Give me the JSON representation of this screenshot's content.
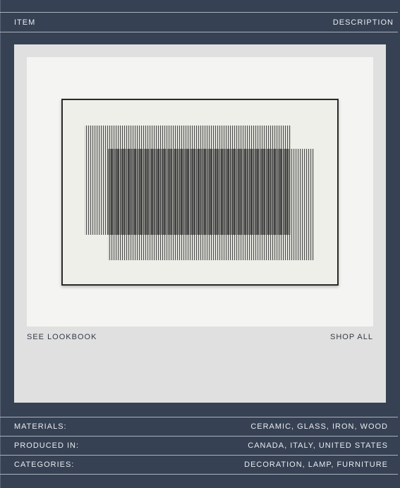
{
  "header": {
    "item_label": "ITEM",
    "description_label": "DESCRIPTION"
  },
  "product_card": {
    "image_alt": "rug",
    "see_lookbook": "SEE LOOKBOOK",
    "shop_all": "SHOP ALL"
  },
  "specs": [
    {
      "label": "MATERIALS:",
      "value": "CERAMIC, GLASS, IRON, WOOD"
    },
    {
      "label": "PRODUCED IN:",
      "value": "CANADA, ITALY, UNITED STATES"
    },
    {
      "label": "CATEGORIES:",
      "value": "DECORATION, LAMP, FURNITURE"
    }
  ],
  "colors": {
    "background": "#364153",
    "divider": "#aab2bf",
    "card": "#e0e0e0",
    "text": "#e9ecf1"
  }
}
